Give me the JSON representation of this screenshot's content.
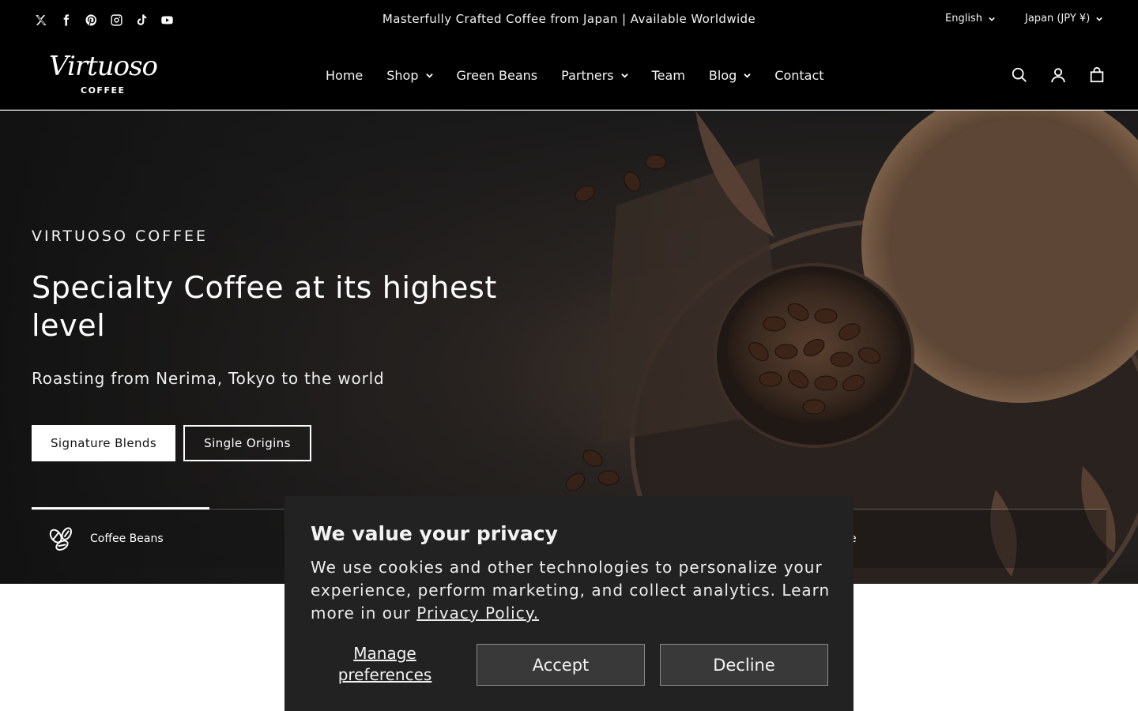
{
  "announcement": {
    "text": "Masterfully Crafted Coffee from Japan | Available Worldwide",
    "socials": [
      "x-icon",
      "facebook-icon",
      "pinterest-icon",
      "instagram-icon",
      "tiktok-icon",
      "youtube-icon"
    ],
    "language": "English",
    "currency": "Japan (JPY ¥)"
  },
  "header": {
    "logo": {
      "script": "Virtuoso",
      "sub": "COFFEE"
    },
    "nav": [
      {
        "label": "Home"
      },
      {
        "label": "Shop"
      },
      {
        "label": "Green Beans"
      },
      {
        "label": "Partners"
      },
      {
        "label": "Team"
      },
      {
        "label": "Blog"
      },
      {
        "label": "Contact"
      }
    ],
    "icons": [
      "search-icon",
      "account-icon",
      "cart-icon"
    ]
  },
  "hero": {
    "eyebrow": "VIRTUOSO COFFEE",
    "title": "Specialty Coffee at its highest level",
    "subtitle": "Roasting from Nerima, Tokyo to the world",
    "primary_button": "Signature Blends",
    "secondary_button": "Single Origins",
    "tabs": [
      {
        "label": "Coffee Beans",
        "icon": "coffee-beans-icon"
      },
      {
        "label": "e"
      }
    ]
  },
  "cookie": {
    "title": "We value your privacy",
    "text": "We use cookies and other technologies to personalize your experience, perform marketing, and collect analytics. Learn more in our ",
    "link": "Privacy Policy.",
    "manage": "Manage preferences",
    "accept": "Accept",
    "decline": "Decline"
  },
  "colors": {
    "bar_bg": "#000000",
    "cookie_bg": "#222222",
    "cookie_button_bg": "#393939"
  }
}
